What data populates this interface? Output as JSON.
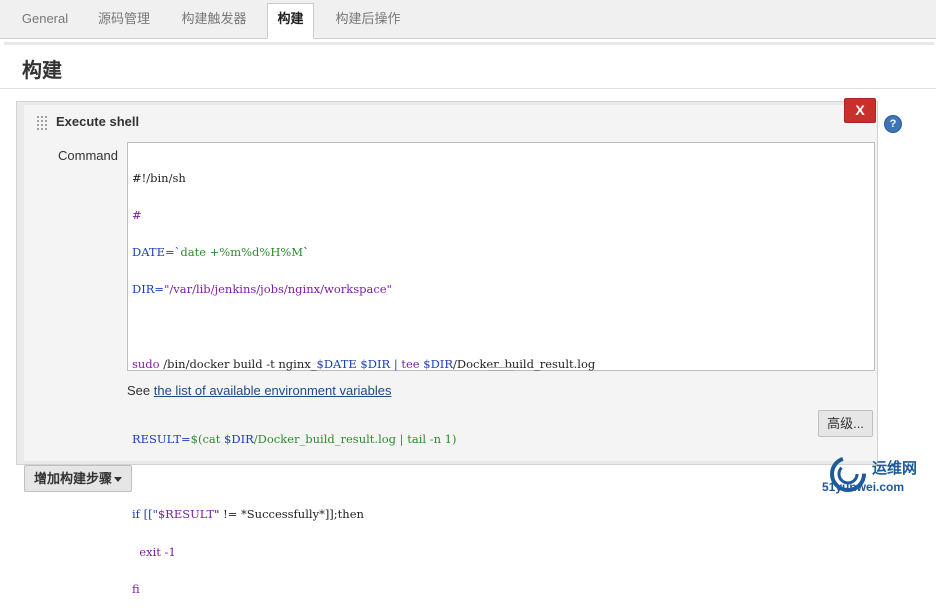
{
  "tabs": [
    {
      "label": "General",
      "active": false
    },
    {
      "label": "源码管理",
      "active": false
    },
    {
      "label": "构建触发器",
      "active": false
    },
    {
      "label": "构建",
      "active": true
    },
    {
      "label": "构建后操作",
      "active": false
    }
  ],
  "section": {
    "title": "构建"
  },
  "build_step": {
    "title": "Execute shell",
    "delete_label": "X",
    "help_label": "?",
    "command_label": "Command",
    "command_lines": {
      "l1": "#!/bin/sh",
      "l2": "#",
      "l3a": "DATE=`",
      "l3b": "date +%m%d%H%M",
      "l3c": "`",
      "l4a": "DIR=",
      "l4b": "\"/var/lib/jenkins/jobs/nginx/workspace\"",
      "l5a": "sudo",
      "l5b": " /bin/docker build -t nginx_",
      "l5c": "$DATE $DIR",
      "l5d": " | ",
      "l5e": "tee",
      "l5f": " $DIR",
      "l5g": "/Docker_build_result.log",
      "l6a": "RESULT=",
      "l6b": "$(cat ",
      "l6c": "$DIR",
      "l6d": "/Docker_build_result.log | tail -n 1)",
      "l7a": "if [[\"",
      "l7b": "$RESULT",
      "l7c": "\" != *Successfully*]];then",
      "l8": "  exit -1",
      "l9": "fi"
    },
    "env_prefix": "See ",
    "env_link": "the list of available environment variables",
    "advanced_label": "高级..."
  },
  "add_step_label": "增加构建步骤",
  "watermark": {
    "name": "运维网",
    "site": "51yunwei.com"
  },
  "colors": {
    "delete": "#c9302c",
    "help": "#3d76b8",
    "link": "#204a87"
  }
}
